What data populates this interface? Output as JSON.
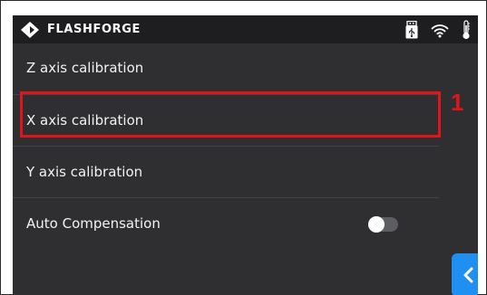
{
  "header": {
    "brand_name": "FLASHFORGE",
    "logo_icon": "flashforge-logo-icon",
    "status_icons": [
      "usb-drive-icon",
      "wifi-icon",
      "thermometer-icon"
    ]
  },
  "menu": {
    "items": [
      {
        "label": "Z axis calibration"
      },
      {
        "label": "X axis calibration"
      },
      {
        "label": "Y axis calibration"
      },
      {
        "label": "Auto Compensation",
        "toggle_on": false
      }
    ]
  },
  "annotation": {
    "step_number": "1",
    "color": "#e0141c"
  },
  "back_button": {
    "icon": "chevron-left-icon",
    "color": "#1f8ff2"
  },
  "colors": {
    "screen_background": "#2f2f31",
    "statusbar_background": "#1e1e20",
    "text": "#f2f2f2"
  }
}
